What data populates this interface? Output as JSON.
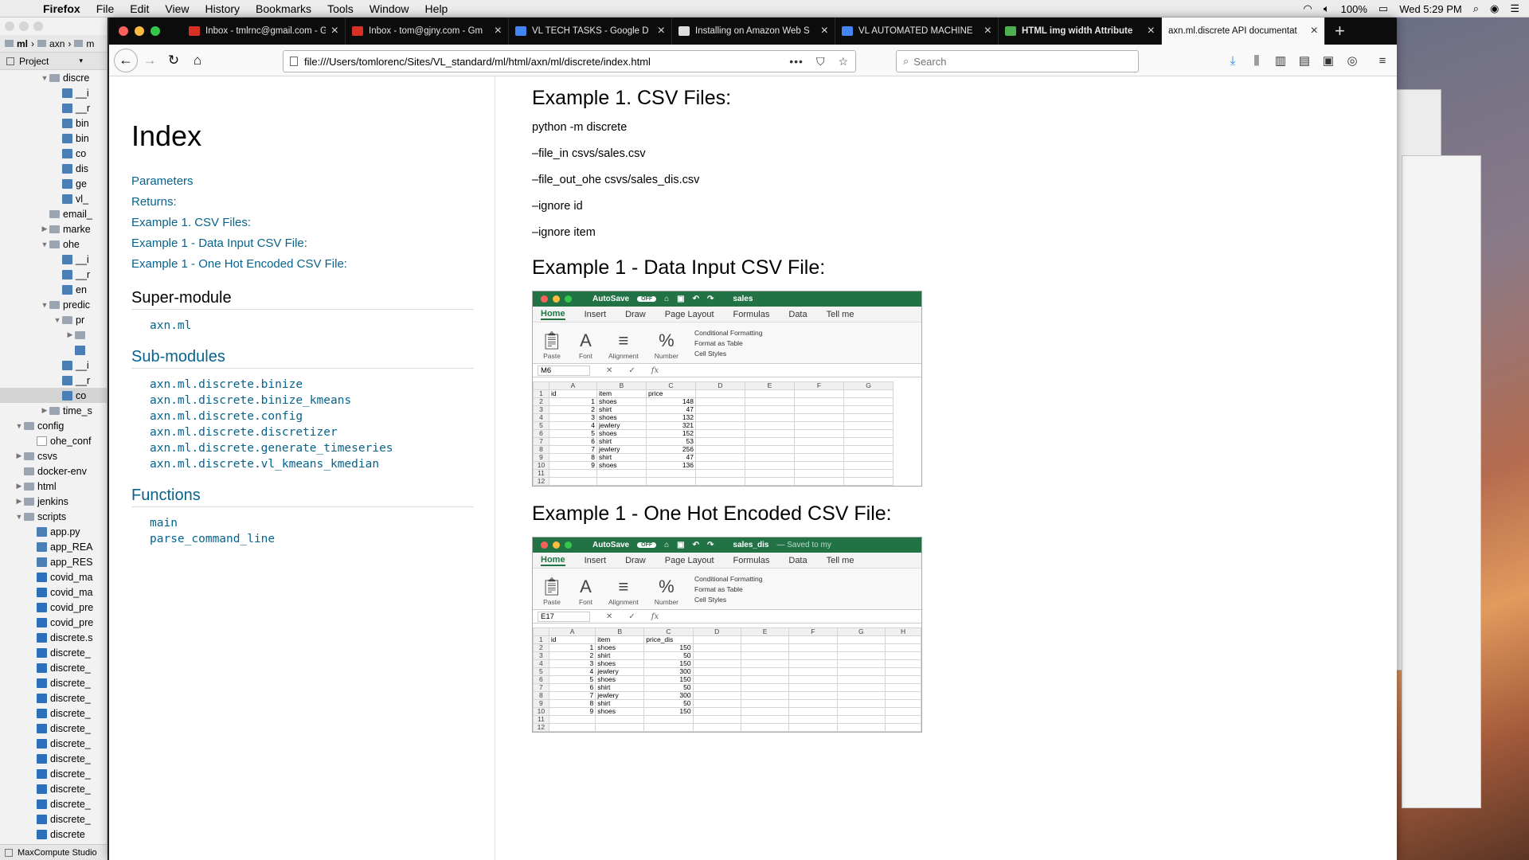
{
  "menubar": {
    "app": "Firefox",
    "items": [
      "File",
      "Edit",
      "View",
      "History",
      "Bookmarks",
      "Tools",
      "Window",
      "Help"
    ],
    "battery": "100%",
    "clock": "Wed 5:29 PM"
  },
  "ide": {
    "breadcrumbs": [
      "ml",
      "axn",
      "m"
    ],
    "project_label": "Project",
    "tree": [
      {
        "depth": 3,
        "arrow": "▼",
        "type": "folder",
        "label": "discre"
      },
      {
        "depth": 4,
        "arrow": "",
        "type": "py",
        "label": "__i"
      },
      {
        "depth": 4,
        "arrow": "",
        "type": "py",
        "label": "__r"
      },
      {
        "depth": 4,
        "arrow": "",
        "type": "py",
        "label": "bin"
      },
      {
        "depth": 4,
        "arrow": "",
        "type": "py",
        "label": "bin"
      },
      {
        "depth": 4,
        "arrow": "",
        "type": "py",
        "label": "co"
      },
      {
        "depth": 4,
        "arrow": "",
        "type": "py",
        "label": "dis"
      },
      {
        "depth": 4,
        "arrow": "",
        "type": "py",
        "label": "ge"
      },
      {
        "depth": 4,
        "arrow": "",
        "type": "py",
        "label": "vl_"
      },
      {
        "depth": 3,
        "arrow": "",
        "type": "folder",
        "label": "email_"
      },
      {
        "depth": 3,
        "arrow": "▶",
        "type": "folder",
        "label": "marke"
      },
      {
        "depth": 3,
        "arrow": "▼",
        "type": "folder",
        "label": "ohe"
      },
      {
        "depth": 4,
        "arrow": "",
        "type": "py",
        "label": "__i"
      },
      {
        "depth": 4,
        "arrow": "",
        "type": "py",
        "label": "__r"
      },
      {
        "depth": 4,
        "arrow": "",
        "type": "py",
        "label": "en"
      },
      {
        "depth": 3,
        "arrow": "▼",
        "type": "folder",
        "label": "predic"
      },
      {
        "depth": 4,
        "arrow": "▼",
        "type": "folder",
        "label": "pr"
      },
      {
        "depth": 5,
        "arrow": "▶",
        "type": "folder",
        "label": ""
      },
      {
        "depth": 5,
        "arrow": "",
        "type": "py",
        "label": ""
      },
      {
        "depth": 4,
        "arrow": "",
        "type": "py",
        "label": "__i"
      },
      {
        "depth": 4,
        "arrow": "",
        "type": "py",
        "label": "__r"
      },
      {
        "depth": 4,
        "arrow": "",
        "type": "py",
        "label": "co",
        "selected": true
      },
      {
        "depth": 3,
        "arrow": "▶",
        "type": "folder",
        "label": "time_s"
      },
      {
        "depth": 1,
        "arrow": "▼",
        "type": "folder",
        "label": "config"
      },
      {
        "depth": 2,
        "arrow": "",
        "type": "file",
        "label": "ohe_conf"
      },
      {
        "depth": 1,
        "arrow": "▶",
        "type": "folder",
        "label": "csvs"
      },
      {
        "depth": 1,
        "arrow": "",
        "type": "folder",
        "label": "docker-env"
      },
      {
        "depth": 1,
        "arrow": "▶",
        "type": "folder",
        "label": "html"
      },
      {
        "depth": 1,
        "arrow": "▶",
        "type": "folder",
        "label": "jenkins"
      },
      {
        "depth": 1,
        "arrow": "▼",
        "type": "folder",
        "label": "scripts"
      },
      {
        "depth": 2,
        "arrow": "",
        "type": "py",
        "label": "app.py"
      },
      {
        "depth": 2,
        "arrow": "",
        "type": "py",
        "label": "app_REA"
      },
      {
        "depth": 2,
        "arrow": "",
        "type": "py",
        "label": "app_RES"
      },
      {
        "depth": 2,
        "arrow": "",
        "type": "sh",
        "label": "covid_ma"
      },
      {
        "depth": 2,
        "arrow": "",
        "type": "sh",
        "label": "covid_ma"
      },
      {
        "depth": 2,
        "arrow": "",
        "type": "sh",
        "label": "covid_pre"
      },
      {
        "depth": 2,
        "arrow": "",
        "type": "sh",
        "label": "covid_pre"
      },
      {
        "depth": 2,
        "arrow": "",
        "type": "sh",
        "label": "discrete.s"
      },
      {
        "depth": 2,
        "arrow": "",
        "type": "sh",
        "label": "discrete_"
      },
      {
        "depth": 2,
        "arrow": "",
        "type": "sh",
        "label": "discrete_"
      },
      {
        "depth": 2,
        "arrow": "",
        "type": "sh",
        "label": "discrete_"
      },
      {
        "depth": 2,
        "arrow": "",
        "type": "sh",
        "label": "discrete_"
      },
      {
        "depth": 2,
        "arrow": "",
        "type": "sh",
        "label": "discrete_"
      },
      {
        "depth": 2,
        "arrow": "",
        "type": "sh",
        "label": "discrete_"
      },
      {
        "depth": 2,
        "arrow": "",
        "type": "sh",
        "label": "discrete_"
      },
      {
        "depth": 2,
        "arrow": "",
        "type": "sh",
        "label": "discrete_"
      },
      {
        "depth": 2,
        "arrow": "",
        "type": "sh",
        "label": "discrete_"
      },
      {
        "depth": 2,
        "arrow": "",
        "type": "sh",
        "label": "discrete_"
      },
      {
        "depth": 2,
        "arrow": "",
        "type": "sh",
        "label": "discrete_"
      },
      {
        "depth": 2,
        "arrow": "",
        "type": "sh",
        "label": "discrete_"
      },
      {
        "depth": 2,
        "arrow": "",
        "type": "sh",
        "label": "discrete"
      }
    ],
    "status": "MaxCompute Studio"
  },
  "browser": {
    "tabs": [
      {
        "title": "Inbox - tmlrnc@gmail.com - Gm",
        "favicon": "gmail-icon",
        "color": "#d93025"
      },
      {
        "title": "Inbox - tom@gjny.com - Gm",
        "favicon": "gmail-icon",
        "color": "#d93025"
      },
      {
        "title": "VL TECH TASKS - Google D",
        "favicon": "docs-icon",
        "color": "#4285f4"
      },
      {
        "title": "Installing on Amazon Web S",
        "favicon": "page-icon",
        "color": "#dddddd"
      },
      {
        "title": "VL AUTOMATED MACHINE",
        "favicon": "docs-icon",
        "color": "#4285f4"
      },
      {
        "title": "HTML img width Attribute",
        "favicon": "w3-icon",
        "color": "#4caf50",
        "bold": true
      },
      {
        "title": "axn.ml.discrete API documentat",
        "favicon": "",
        "color": "",
        "active": true
      }
    ],
    "url": "file:///Users/tomlorenc/Sites/VL_standard/ml/html/axn/ml/discrete/index.html",
    "search_placeholder": "Search"
  },
  "doc": {
    "index_title": "Index",
    "toc": [
      "Parameters",
      "Returns:",
      "Example 1. CSV Files:",
      "Example 1 - Data Input CSV File:",
      "Example 1 - One Hot Encoded CSV File:"
    ],
    "super_module_heading": "Super-module",
    "super_module": [
      "axn.ml"
    ],
    "sub_modules_heading": "Sub-modules",
    "sub_modules": [
      "axn.ml.discrete.binize",
      "axn.ml.discrete.binize_kmeans",
      "axn.ml.discrete.config",
      "axn.ml.discrete.discretizer",
      "axn.ml.discrete.generate_timeseries",
      "axn.ml.discrete.vl_kmeans_kmedian"
    ],
    "functions_heading": "Functions",
    "functions": [
      "main",
      "parse_command_line"
    ],
    "ex1_title": "Example 1. CSV Files:",
    "ex1_lines": [
      "python -m discrete",
      "–file_in csvs/sales.csv",
      "–file_out_ohe csvs/sales_dis.csv",
      "–ignore id",
      "–ignore item"
    ],
    "ex2_title": "Example 1 - Data Input CSV File:",
    "ex3_title": "Example 1 - One Hot Encoded CSV File:"
  },
  "excel1": {
    "title": "sales",
    "autosave": "AutoSave",
    "off": "OFF",
    "ribbon_tabs": [
      "Home",
      "Insert",
      "Draw",
      "Page Layout",
      "Formulas",
      "Data",
      "Tell me"
    ],
    "groups": [
      "Paste",
      "Font",
      "Alignment",
      "Number"
    ],
    "styles": [
      "Conditional Formatting",
      "Format as Table",
      "Cell Styles"
    ],
    "namebox": "M6",
    "columns": [
      "A",
      "B",
      "C",
      "D",
      "E",
      "F",
      "G"
    ],
    "rows": [
      [
        "id",
        "item",
        "price"
      ],
      [
        "1",
        "shoes",
        "148"
      ],
      [
        "2",
        "shirt",
        "47"
      ],
      [
        "3",
        "shoes",
        "132"
      ],
      [
        "4",
        "jewlery",
        "321"
      ],
      [
        "5",
        "shoes",
        "152"
      ],
      [
        "6",
        "shirt",
        "53"
      ],
      [
        "7",
        "jewlery",
        "256"
      ],
      [
        "8",
        "shirt",
        "47"
      ],
      [
        "9",
        "shoes",
        "136"
      ],
      [
        "",
        "",
        ""
      ],
      [
        "",
        "",
        ""
      ],
      [
        "",
        "",
        ""
      ]
    ]
  },
  "excel2": {
    "title": "sales_dis",
    "subtitle": "— Saved to my",
    "autosave": "AutoSave",
    "off": "OFF",
    "ribbon_tabs": [
      "Home",
      "Insert",
      "Draw",
      "Page Layout",
      "Formulas",
      "Data",
      "Tell me"
    ],
    "groups": [
      "Paste",
      "Font",
      "Alignment",
      "Number"
    ],
    "styles": [
      "Conditional Formatting",
      "Format as Table",
      "Cell Styles"
    ],
    "namebox": "E17",
    "columns": [
      "A",
      "B",
      "C",
      "D",
      "E",
      "F",
      "G",
      "H"
    ],
    "rows": [
      [
        "id",
        "item",
        "price_dis"
      ],
      [
        "1",
        "shoes",
        "150"
      ],
      [
        "2",
        "shirt",
        "50"
      ],
      [
        "3",
        "shoes",
        "150"
      ],
      [
        "4",
        "jewlery",
        "300"
      ],
      [
        "5",
        "shoes",
        "150"
      ],
      [
        "6",
        "shirt",
        "50"
      ],
      [
        "7",
        "jewlery",
        "300"
      ],
      [
        "8",
        "shirt",
        "50"
      ],
      [
        "9",
        "shoes",
        "150"
      ],
      [
        "",
        "",
        ""
      ],
      [
        "",
        "",
        ""
      ],
      [
        "",
        "",
        ""
      ],
      [
        "",
        "",
        ""
      ],
      [
        "",
        "",
        ""
      ]
    ]
  }
}
